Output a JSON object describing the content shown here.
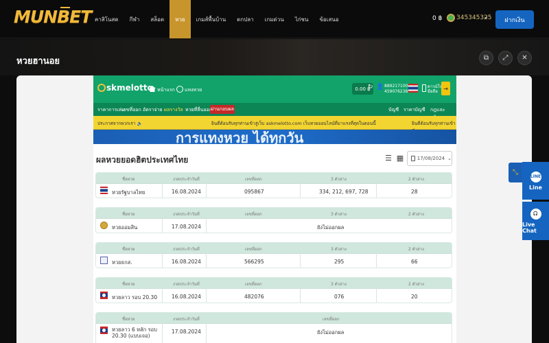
{
  "brand": {
    "logo_text": "MUNBET"
  },
  "nav": {
    "items": [
      "คาสิโนสด",
      "กีฬา",
      "สล็อต",
      "หวย",
      "เกมส์พื้นบ้าน",
      "ตกปลา",
      "เกมด่วน",
      "ไก่ชน",
      "ข้อเสนอ"
    ],
    "active_index": 3
  },
  "account": {
    "credit": "0 ฿",
    "balance": "345345325",
    "deposit_label": "ฝากเงิน"
  },
  "page": {
    "title": "หวยฮานอย"
  },
  "lotto": {
    "logo": "skmelotto",
    "home": "หน้าแรก",
    "lang": "แทงหวย",
    "balance": "0.00 ฿",
    "phone1": "88921710000",
    "phone2": "459076238...",
    "download1": "ดาวน์โหลด",
    "download2": "มือถือ",
    "menu": [
      "ราคาการเล่น",
      "เลขที่ออก",
      "อัตราจ่าย",
      "ผลรางวัล",
      "หวยที่ลื่นออก",
      "ผ่านกอบผล"
    ],
    "menu_right": [
      "บัญชี",
      "ราคาบัญชี",
      "กฎและกติกา"
    ],
    "ticker_label": "ประกาศจากพวกเรา",
    "ticker_text": "ยินดีต้อนรับทุกท่านเข้าสู่เว็บ askmelotto.com เว็บหวยออนไลน์ที่มาแรงที่สุดในตอนนี้",
    "ticker_right": "ยินดีต้อนรับทุกท่านเข้าสู่"
  },
  "results": {
    "title": "ผลหวยยอดฮิตประเทศไทย",
    "date": "17/08/2024",
    "headers": {
      "name": "ชื่อหวย",
      "date": "งวดประจำวันที่",
      "number": "เลขที่ออก",
      "three": "3 ตัวล่าง",
      "two": "2 ตัวล่าง"
    },
    "rows": [
      {
        "name": "หวยรัฐบาลไทย",
        "date": "16.08.2024",
        "number": "095867",
        "three": "334, 212, 697, 728",
        "two": "28",
        "flag": "thai"
      },
      {
        "name": "หวยออมสิน",
        "date": "17.08.2024",
        "status": "ยังไม่ออกผล",
        "flag": "seal"
      },
      {
        "name": "หวยธกส.",
        "date": "16.08.2024",
        "number": "566295",
        "three": "295",
        "two": "66",
        "flag": "gsb"
      },
      {
        "name": "หวยลาว รอบ 20.30",
        "date": "16.08.2024",
        "number": "482076",
        "three": "076",
        "two": "20",
        "flag": "laos"
      },
      {
        "name": "หวยลาว 6 หลัก รอบ 20.30 (แบบเจอ)",
        "date": "17.08.2024",
        "status": "ยังไม่ออกผล",
        "flag": "laos"
      }
    ]
  },
  "side": {
    "line_label": "Line",
    "live_chat_label": "Live Chat"
  },
  "colors": {
    "brand_gold": "#f0b93a",
    "active_nav": "#c8952c",
    "deposit": "#1565c0",
    "lotto_green": "#12a36a",
    "ticker": "#f3d531"
  }
}
